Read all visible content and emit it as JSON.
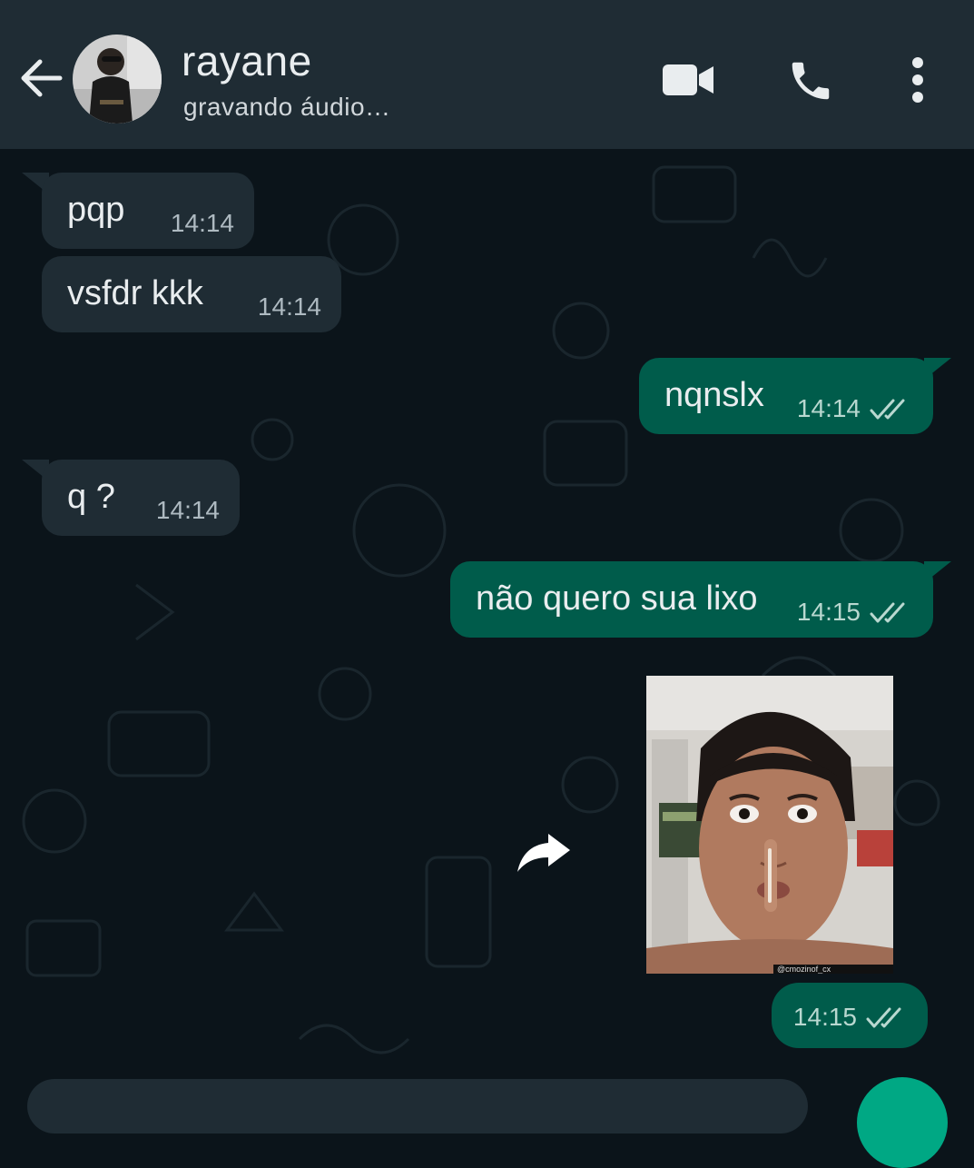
{
  "header": {
    "contact_name": "rayane",
    "contact_status": "gravando áudio…",
    "icons": [
      "back-arrow-icon",
      "video-call-icon",
      "phone-call-icon",
      "more-options-icon"
    ]
  },
  "messages": [
    {
      "direction": "incoming",
      "text": "pqp",
      "time": "14:14"
    },
    {
      "direction": "incoming",
      "text": "vsfdr kkk",
      "time": "14:14"
    },
    {
      "direction": "outgoing",
      "text": "nqnslx",
      "time": "14:14",
      "status": "read"
    },
    {
      "direction": "incoming",
      "text": "q ?",
      "time": "14:14"
    },
    {
      "direction": "outgoing",
      "text": "não quero sua lixo",
      "time": "14:15",
      "status": "read"
    },
    {
      "direction": "outgoing",
      "type": "image",
      "text": "",
      "time": "14:15",
      "status": "read",
      "watermark": "@cmozinof_cx"
    }
  ],
  "colors": {
    "background": "#0b141a",
    "header": "#1f2c34",
    "incoming_bubble": "#1f2c34",
    "outgoing_bubble": "#005c4b",
    "read_ticks": "#b9d8d0"
  }
}
